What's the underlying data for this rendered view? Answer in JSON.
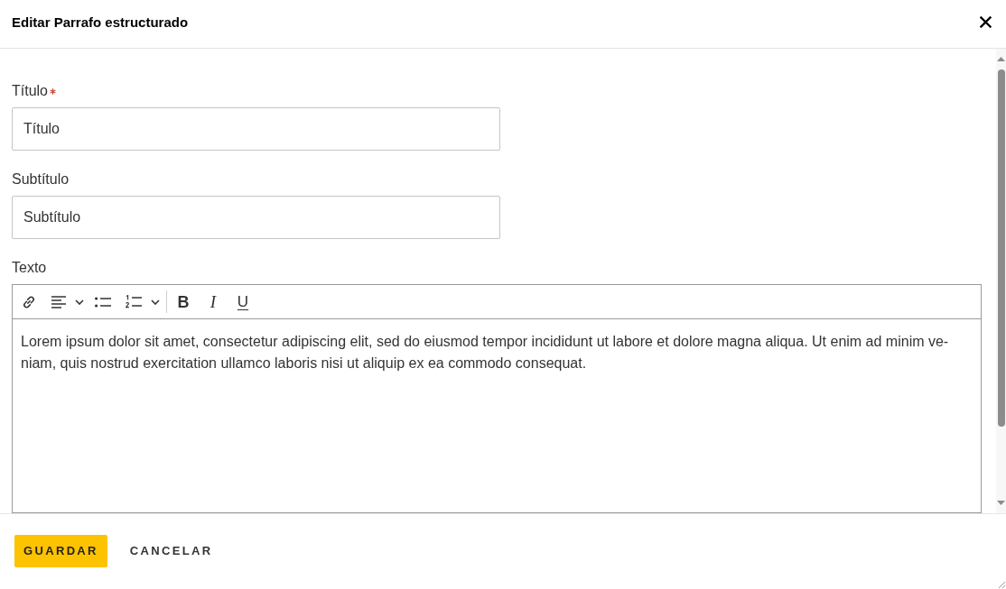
{
  "dialog": {
    "title": "Editar Parrafo estructurado"
  },
  "fields": [
    {
      "kind": "text",
      "label": "Título",
      "required": true,
      "value": "Título"
    },
    {
      "kind": "text",
      "label": "Subtítulo",
      "required": false,
      "value": "Subtítulo"
    },
    {
      "kind": "rich_text",
      "label": "Texto",
      "required": false,
      "format_buttons": [
        {
          "kind": "bold",
          "label": "B"
        },
        {
          "kind": "italic",
          "label": "I"
        },
        {
          "kind": "underline",
          "label": "U"
        }
      ],
      "value": "Lorem ipsum dolor sit amet, consectetur adipiscing elit, sed do eiusmod tempor incididunt ut labore et dolore magna aliqua. Ut enim ad minim ve-\nniam, quis nostrud exercitation ullamco laboris nisi ut aliquip ex ea commodo consequat."
    }
  ],
  "buttons": [
    {
      "kind": "primary",
      "label": "GUARDAR"
    },
    {
      "kind": "text",
      "label": "CANCELAR"
    }
  ]
}
